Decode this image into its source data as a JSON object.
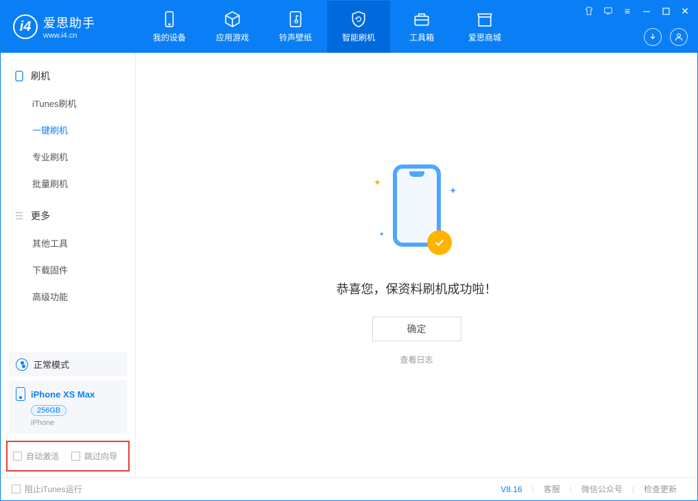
{
  "brand": {
    "title": "爱思助手",
    "subtitle": "www.i4.cn"
  },
  "tabs": {
    "device": "我的设备",
    "apps": "应用游戏",
    "ring": "铃声壁纸",
    "flash": "智能刷机",
    "toolbox": "工具箱",
    "store": "爱思商城"
  },
  "sidebar": {
    "group1": {
      "title": "刷机",
      "items": [
        "iTunes刷机",
        "一键刷机",
        "专业刷机",
        "批量刷机"
      ]
    },
    "group2": {
      "title": "更多",
      "items": [
        "其他工具",
        "下载固件",
        "高级功能"
      ]
    }
  },
  "status": {
    "mode": "正常模式"
  },
  "device": {
    "name": "iPhone XS Max",
    "storage": "256GB",
    "type": "iPhone"
  },
  "redbox": {
    "auto_activate": "自动激活",
    "skip_guide": "跳过向导"
  },
  "main": {
    "success": "恭喜您，保资料刷机成功啦！",
    "ok": "确定",
    "view_log": "查看日志"
  },
  "footer": {
    "block_itunes": "阻止iTunes运行",
    "version": "V8.16",
    "service": "客服",
    "wechat": "微信公众号",
    "update": "检查更新"
  }
}
